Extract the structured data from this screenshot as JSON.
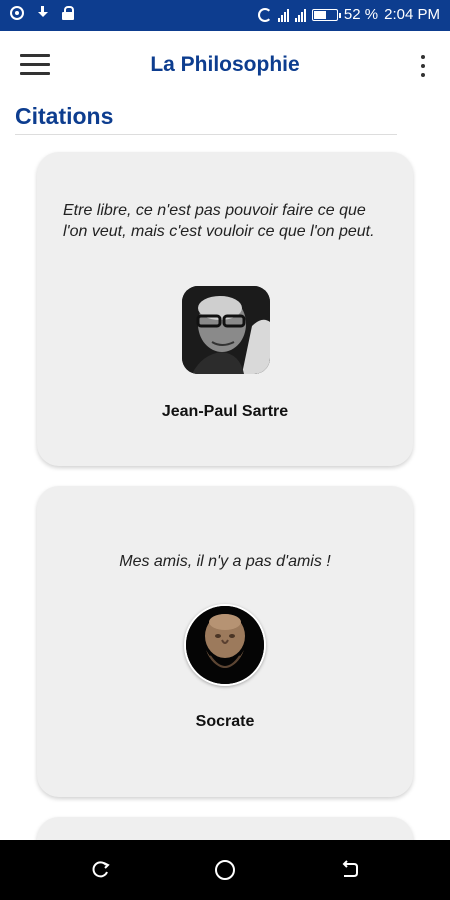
{
  "status_bar": {
    "battery_percent": "52 %",
    "time": "2:04 PM",
    "battery_level": 0.52,
    "icons": [
      "record-icon",
      "download-icon",
      "lock-icon",
      "nfc-icon",
      "signal-icon",
      "signal-icon",
      "battery-icon"
    ]
  },
  "app_bar": {
    "title": "La Philosophie",
    "menu_icon": "hamburger-menu-icon",
    "more_icon": "more-vert-icon"
  },
  "section": {
    "title": "Citations"
  },
  "quotes": [
    {
      "text": "Etre libre, ce n'est pas pouvoir faire ce que l'on veut, mais c'est vouloir ce que l'on peut.",
      "author": "Jean-Paul Sartre",
      "portrait": "sartre-portrait"
    },
    {
      "text": "Mes amis, il n'y a pas d'amis !",
      "author": "Socrate",
      "portrait": "socrate-portrait"
    }
  ],
  "nav_bar": {
    "icons": [
      "recent-apps-icon",
      "home-icon",
      "back-icon"
    ]
  },
  "colors": {
    "brand": "#0d3d8f",
    "card": "#efefef"
  }
}
